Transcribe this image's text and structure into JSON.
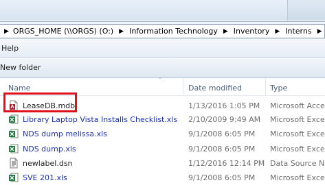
{
  "address": {
    "crumbs": [
      "ORGS_HOME (\\\\ORGS) (O:)",
      "Information Technology",
      "Inventory",
      "Interns"
    ]
  },
  "menu": {
    "help_label": "Help"
  },
  "commands": {
    "new_folder_label": "New folder"
  },
  "columns": {
    "name": "Name",
    "date": "Date modified",
    "type": "Type"
  },
  "files": [
    {
      "name": "LeaseDB.mdb",
      "date": "1/13/2016 1:05 PM",
      "type": "Microsoft Acce",
      "icon": "access-db-icon"
    },
    {
      "name": "Library Laptop Vista Installs Checklist.xls",
      "date": "2/10/2009 9:49 AM",
      "type": "Microsoft Excel",
      "icon": "excel-icon"
    },
    {
      "name": "NDS dump melissa.xls",
      "date": "9/1/2008 6:05 PM",
      "type": "Microsoft Excel",
      "icon": "excel-icon"
    },
    {
      "name": "NDS dump.xls",
      "date": "9/1/2008 6:05 PM",
      "type": "Microsoft Excel",
      "icon": "excel-icon"
    },
    {
      "name": "newlabel.dsn",
      "date": "1/12/2016 12:14 PM",
      "type": "Data Source Nan",
      "icon": "dsn-file-icon"
    },
    {
      "name": "SVE 201.xls",
      "date": "9/1/2008 6:05 PM",
      "type": "Microsoft Excel",
      "icon": "excel-icon"
    }
  ],
  "colors": {
    "highlight": "#e0101b",
    "link": "#1a2fbd"
  }
}
